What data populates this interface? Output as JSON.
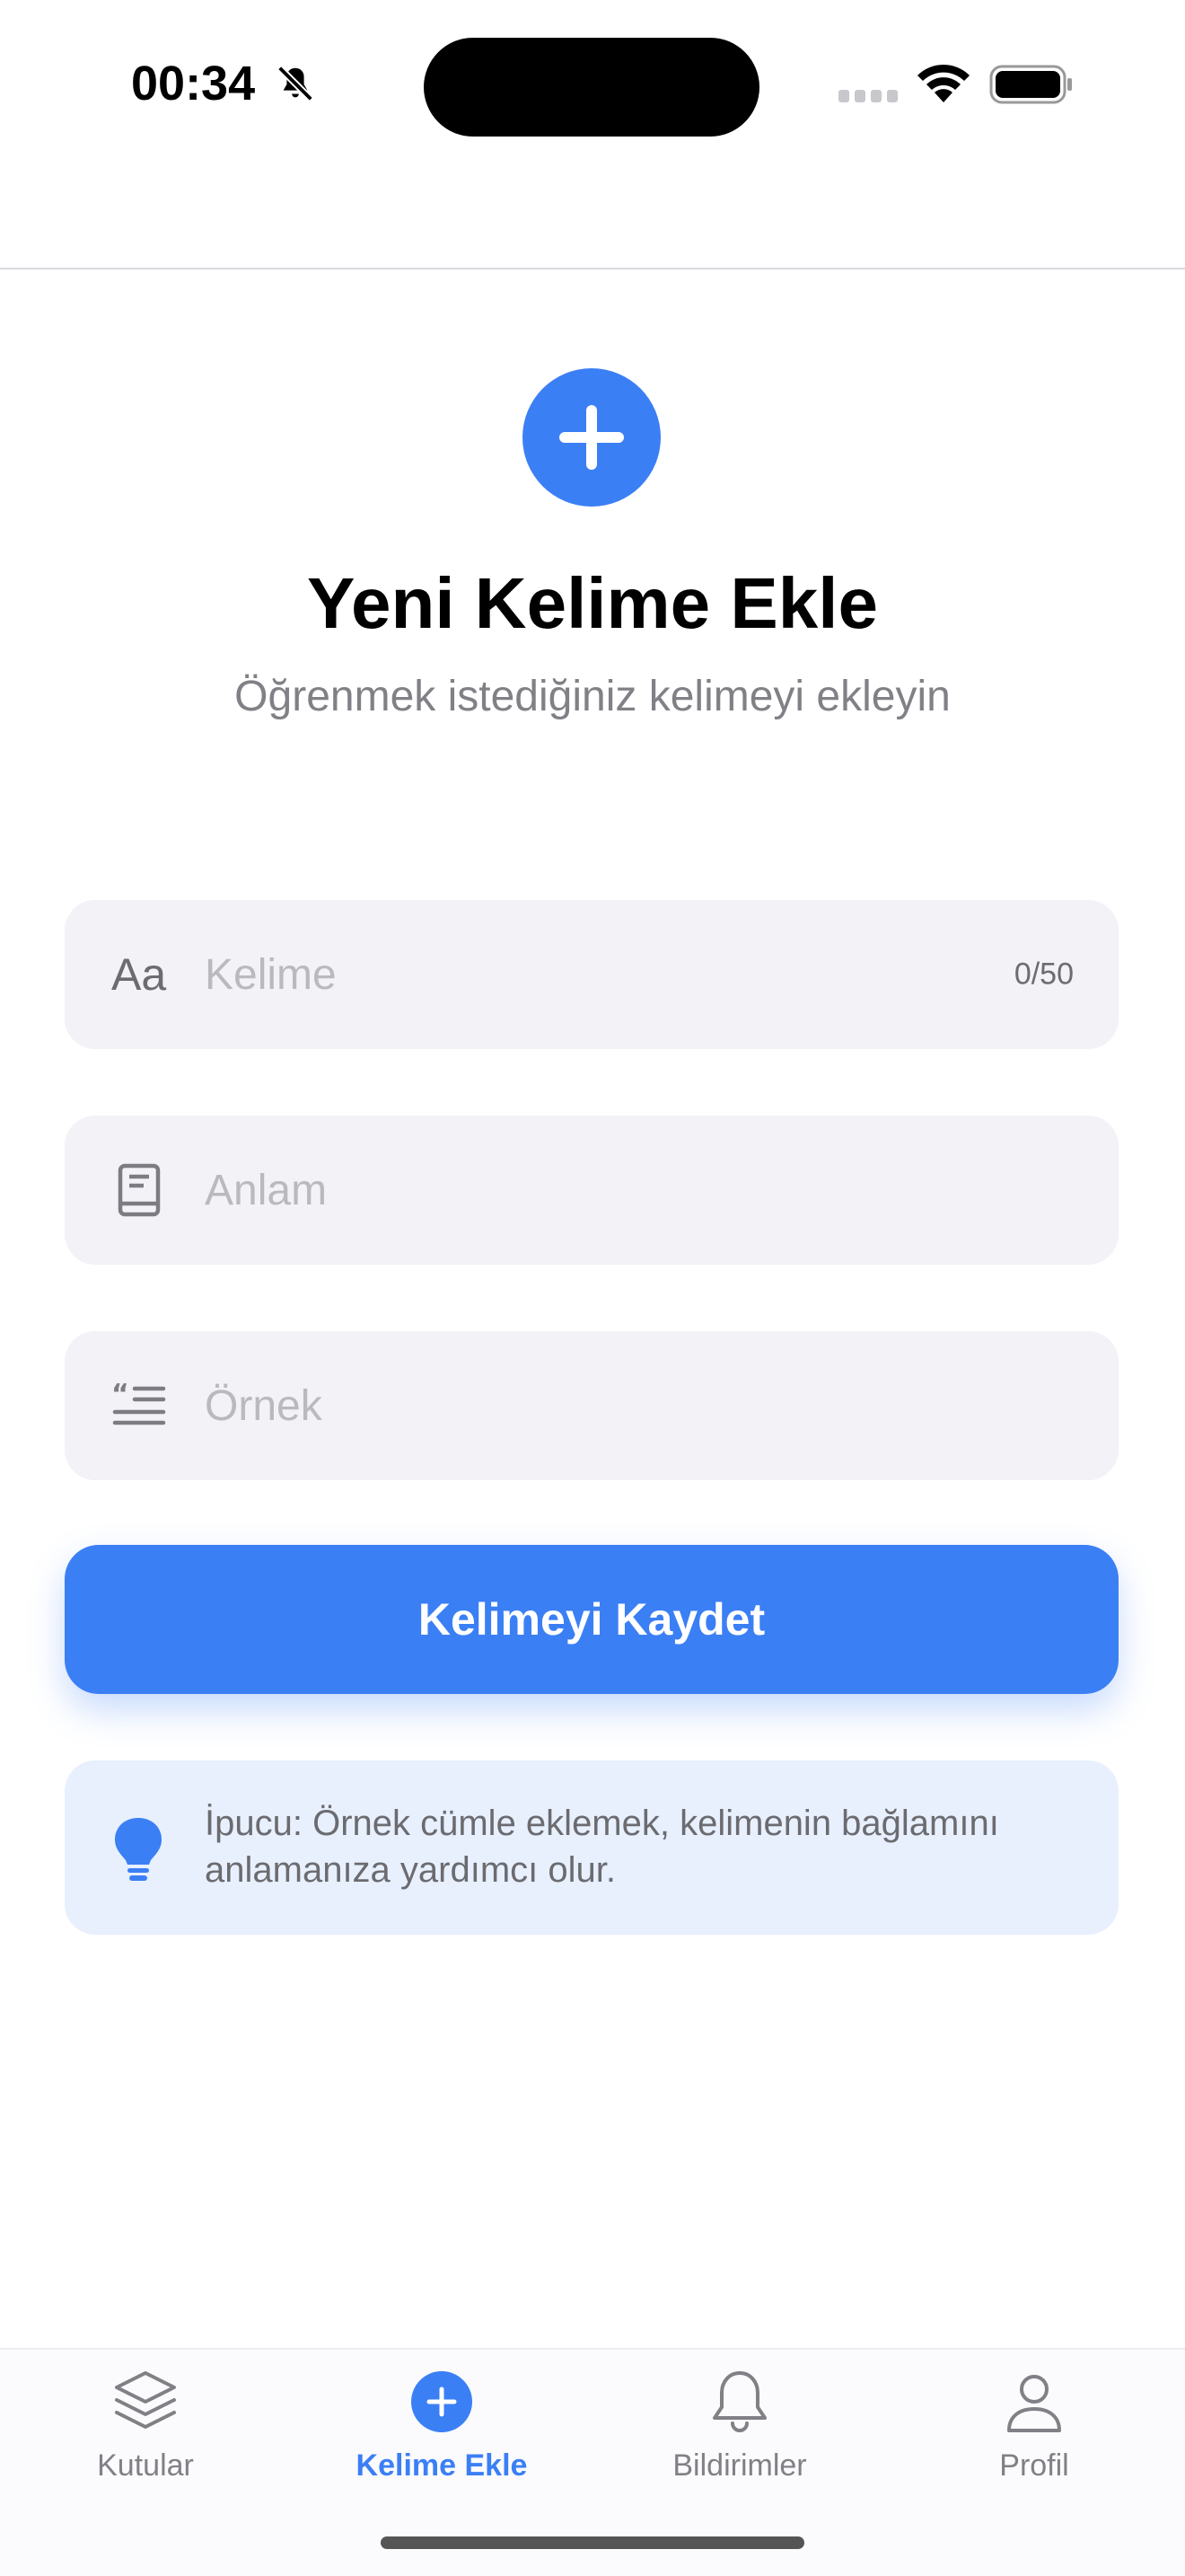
{
  "status_bar": {
    "time": "00:34"
  },
  "header": {
    "title": "Yeni Kelime Ekle",
    "subtitle": "Öğrenmek istediğiniz kelimeyi ekleyin"
  },
  "form": {
    "word": {
      "icon_label": "Aa",
      "placeholder": "Kelime",
      "value": "",
      "counter": "0/50"
    },
    "meaning": {
      "placeholder": "Anlam",
      "value": ""
    },
    "example": {
      "placeholder": "Örnek",
      "value": ""
    },
    "save_label": "Kelimeyi Kaydet"
  },
  "tip": {
    "line1": "İpucu: Örnek cümle eklemek, kelimenin bağlamını",
    "line2": "anlamanıza yardımcı olur."
  },
  "tabs": [
    {
      "label": "Kutular",
      "icon": "stack-icon",
      "active": false
    },
    {
      "label": "Kelime Ekle",
      "icon": "plus-circle-icon",
      "active": true
    },
    {
      "label": "Bildirimler",
      "icon": "bell-icon",
      "active": false
    },
    {
      "label": "Profil",
      "icon": "person-icon",
      "active": false
    }
  ],
  "colors": {
    "accent": "#3b7ff5",
    "field_bg": "#f2f2f7",
    "tip_bg": "#e8f0fe",
    "secondary_text": "#808086"
  }
}
